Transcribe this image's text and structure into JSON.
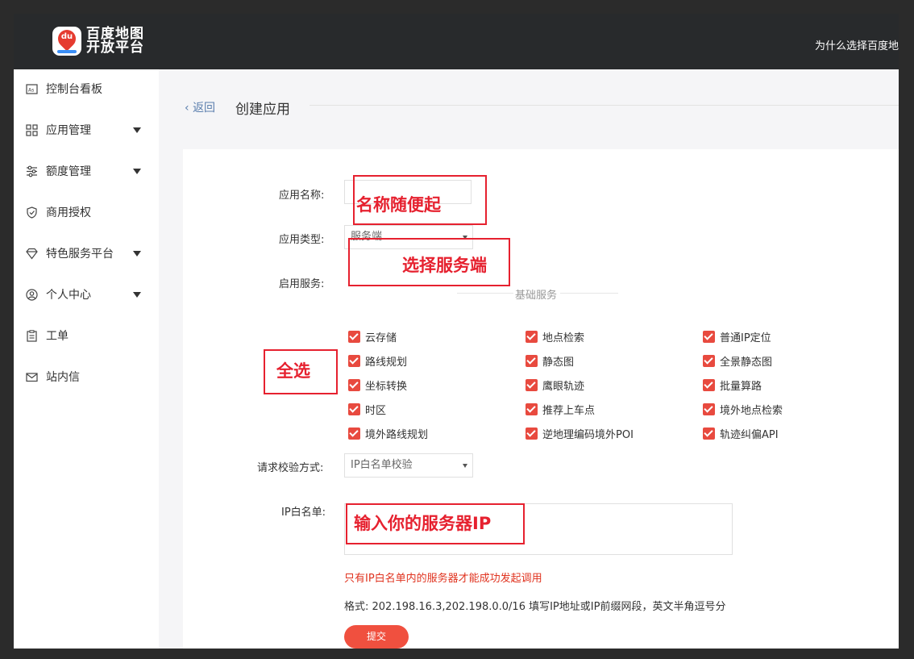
{
  "header": {
    "logo_line1": "百度地图",
    "logo_line2": "开放平台",
    "logo_mark": "du",
    "top_link": "为什么选择百度地"
  },
  "sidebar": {
    "items": [
      {
        "label": "控制台看板",
        "icon": "dashboard-icon",
        "has_caret": false
      },
      {
        "label": "应用管理",
        "icon": "grid-icon",
        "has_caret": true
      },
      {
        "label": "额度管理",
        "icon": "sliders-icon",
        "has_caret": true
      },
      {
        "label": "商用授权",
        "icon": "shield-icon",
        "has_caret": false
      },
      {
        "label": "特色服务平台",
        "icon": "diamond-icon",
        "has_caret": true
      },
      {
        "label": "个人中心",
        "icon": "user-circle-icon",
        "has_caret": true
      },
      {
        "label": "工单",
        "icon": "clipboard-icon",
        "has_caret": false
      },
      {
        "label": "站内信",
        "icon": "mail-icon",
        "has_caret": false
      }
    ]
  },
  "breadcrumb": {
    "back": "返回",
    "title": "创建应用"
  },
  "form": {
    "app_name_label": "应用名称:",
    "app_name_value": "",
    "app_type_label": "应用类型:",
    "app_type_value": "服务端",
    "services_label": "启用服务:",
    "services_section": "基础服务",
    "services": [
      [
        "云存储",
        "地点检索",
        "普通IP定位"
      ],
      [
        "路线规划",
        "静态图",
        "全景静态图"
      ],
      [
        "坐标转换",
        "鹰眼轨迹",
        "批量算路"
      ],
      [
        "时区",
        "推荐上车点",
        "境外地点检索"
      ],
      [
        "境外路线规划",
        "逆地理编码境外POI",
        "轨迹纠偏API"
      ]
    ],
    "verify_label": "请求校验方式:",
    "verify_value": "IP白名单校验",
    "whitelist_label": "IP白名单:",
    "whitelist_value": "",
    "warning": "只有IP白名单内的服务器才能成功发起调用",
    "format_hint": "格式: 202.198.16.3,202.198.0.0/16 填写IP地址或IP前缀网段，英文半角逗号分",
    "submit": "提交"
  },
  "annotations": {
    "name": "名称随便起",
    "type": "选择服务端",
    "select_all": "全选",
    "ip": "输入你的服务器IP"
  },
  "colors": {
    "accent": "#e84a3f",
    "annotation": "#e6212f",
    "topbar": "#282a2c"
  }
}
